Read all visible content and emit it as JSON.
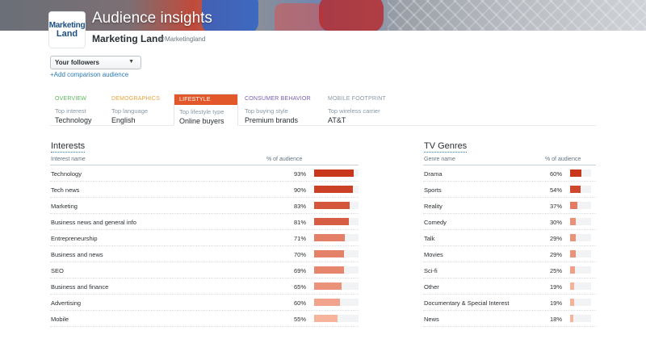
{
  "banner": {
    "title": "Audience insights"
  },
  "logo": {
    "line1": "Marketing",
    "line2": "Land"
  },
  "account": {
    "name": "Marketing Land",
    "handle": "@Marketingland"
  },
  "audience_select": {
    "value": "Your followers",
    "icon": "chevron-down-icon"
  },
  "add_comparison": "+Add comparison audience",
  "tabs": [
    {
      "label": "OVERVIEW",
      "sub": "Top interest",
      "value": "Technology",
      "color": "#5cb85c"
    },
    {
      "label": "DEMOGRAPHICS",
      "sub": "Top language",
      "value": "English",
      "color": "#e8a33d"
    },
    {
      "label": "LIFESTYLE",
      "sub": "Top lifestyle type",
      "value": "Online buyers",
      "color": "#ffffff",
      "active": true
    },
    {
      "label": "CONSUMER BEHAVIOR",
      "sub": "Top buying style",
      "value": "Premium brands",
      "color": "#7a5bb0"
    },
    {
      "label": "MOBILE FOOTPRINT",
      "sub": "Top wireless carrier",
      "value": "AT&T",
      "color": "#8899a6"
    }
  ],
  "interests": {
    "title": "Interests",
    "col_name": "Interest name",
    "col_pct": "% of audience",
    "rows": [
      {
        "name": "Technology",
        "pct": "93%",
        "value": 93
      },
      {
        "name": "Tech news",
        "pct": "90%",
        "value": 90
      },
      {
        "name": "Marketing",
        "pct": "83%",
        "value": 83
      },
      {
        "name": "Business news and general info",
        "pct": "81%",
        "value": 81
      },
      {
        "name": "Entrepreneurship",
        "pct": "71%",
        "value": 71
      },
      {
        "name": "Business and news",
        "pct": "70%",
        "value": 70
      },
      {
        "name": "SEO",
        "pct": "69%",
        "value": 69
      },
      {
        "name": "Business and finance",
        "pct": "65%",
        "value": 65
      },
      {
        "name": "Advertising",
        "pct": "60%",
        "value": 60
      },
      {
        "name": "Mobile",
        "pct": "55%",
        "value": 55
      }
    ]
  },
  "tv_genres": {
    "title": "TV Genres",
    "col_name": "Genre name",
    "col_pct": "% of audience",
    "rows": [
      {
        "name": "Drama",
        "pct": "60%",
        "value": 60
      },
      {
        "name": "Sports",
        "pct": "54%",
        "value": 54
      },
      {
        "name": "Reality",
        "pct": "37%",
        "value": 37
      },
      {
        "name": "Comedy",
        "pct": "30%",
        "value": 30
      },
      {
        "name": "Talk",
        "pct": "29%",
        "value": 29
      },
      {
        "name": "Movies",
        "pct": "29%",
        "value": 29
      },
      {
        "name": "Sci-fi",
        "pct": "25%",
        "value": 25
      },
      {
        "name": "Other",
        "pct": "19%",
        "value": 19
      },
      {
        "name": "Documentary & Special Interest",
        "pct": "19%",
        "value": 19
      },
      {
        "name": "News",
        "pct": "18%",
        "value": 18
      }
    ]
  },
  "colors": {
    "bar_dark": "#c8361b",
    "bar_light": "#f7b49c",
    "accent": "#e2582b",
    "link": "#2b7bb9"
  }
}
